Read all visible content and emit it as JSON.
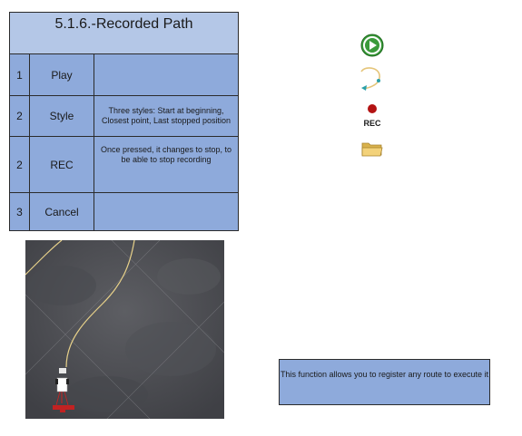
{
  "title": "5.1.6.-Recorded Path",
  "rows": [
    {
      "num": "1",
      "name": "Play",
      "desc": ""
    },
    {
      "num": "2",
      "name": "Style",
      "desc": "Three styles: Start at beginning, Closest point, Last stopped position"
    },
    {
      "num": "2",
      "name": "REC",
      "desc": "Once pressed, it changes to stop, to be able to stop recording"
    },
    {
      "num": "3",
      "name": "Cancel",
      "desc": ""
    }
  ],
  "icons": {
    "play": "play-icon",
    "style": "path-style-icon",
    "rec": "record-icon",
    "rec_label": "REC",
    "cancel": "folder-icon"
  },
  "note": "This function allows you to register any route to execute it",
  "colors": {
    "header": "#b4c7e7",
    "cell": "#8eaadb",
    "play_green": "#3a9a3a",
    "rec_red": "#b31313",
    "path_yellow": "#e7d18a"
  }
}
